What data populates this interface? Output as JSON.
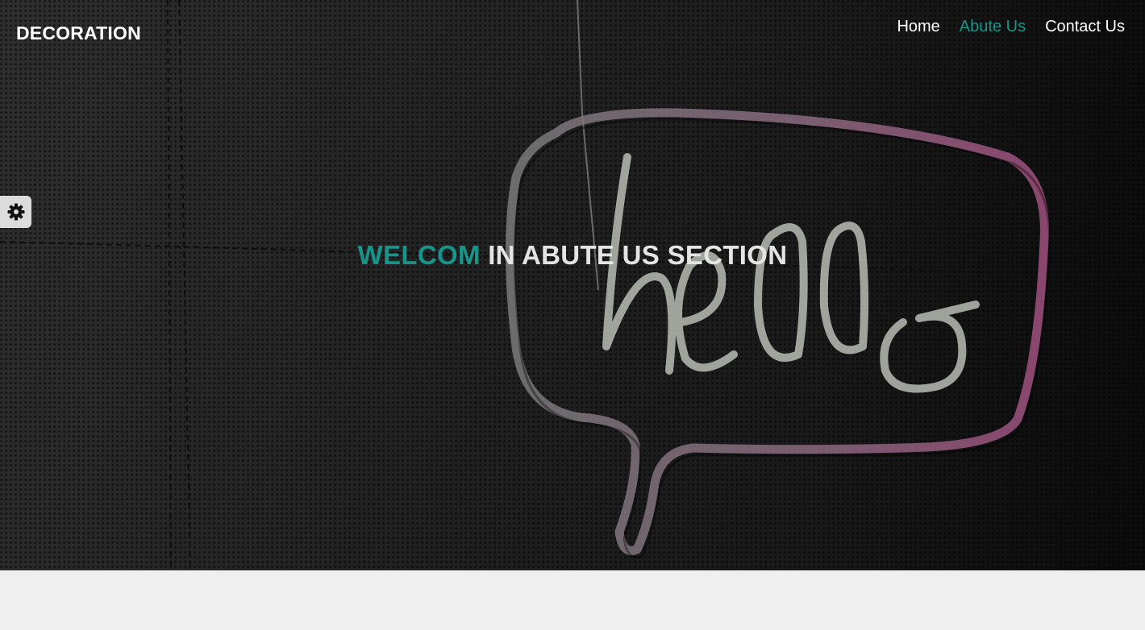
{
  "brand": {
    "name": "DECORATION"
  },
  "nav": {
    "items": [
      {
        "label": "Home",
        "active": false
      },
      {
        "label": "Abute Us",
        "active": true
      },
      {
        "label": "Contact Us",
        "active": false
      }
    ]
  },
  "hero": {
    "headline_accent": "WELCOM",
    "headline_rest": " IN ABUTE US SECTION",
    "photo_text": "hello"
  },
  "settings": {
    "icon": "gear-icon"
  },
  "colors": {
    "accent": "#16968a",
    "nav_text": "#ffffff",
    "headline_text": "#e4e4e4",
    "page_background": "#efefef"
  }
}
